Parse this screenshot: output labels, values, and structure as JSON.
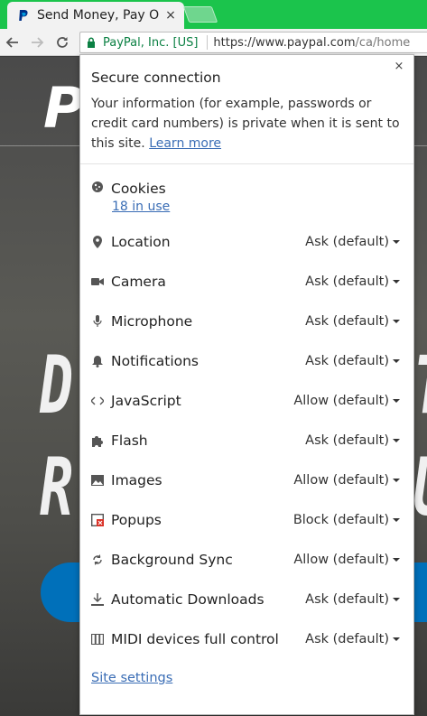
{
  "browser": {
    "tab": {
      "title": "Send Money, Pay O",
      "close_glyph": "×",
      "favicon": "paypal-favicon-icon"
    },
    "new_tab_icon": "new-tab-icon",
    "tabstrip_color": "#1bc44c",
    "nav": {
      "back": "arrow-left-icon",
      "forward": "arrow-right-icon",
      "reload": "reload-icon"
    },
    "omnibox": {
      "security_label": "PayPal, Inc. [US]",
      "url_scheme_host": "https://www.paypal.com",
      "url_path": "/ca/home",
      "secure_color": "#0b8043"
    }
  },
  "background_page": {
    "logo_letter": "P",
    "headline_line1": "D",
    "headline_line2": "R",
    "headline_line1_right": "T",
    "headline_line2_right": "U",
    "button_color": "#0070ba"
  },
  "site_info_popup": {
    "close_glyph": "×",
    "heading": "Secure connection",
    "description": "Your information (for example, passwords or credit card numbers) is private when it is sent to this site.",
    "learn_more": "Learn more",
    "link_color": "#3a6db5",
    "cookies": {
      "label": "Cookies",
      "count_link": "18 in use",
      "icon": "cookie-icon"
    },
    "permissions": [
      {
        "label": "Location",
        "value": "Ask (default)",
        "icon": "location-pin-icon"
      },
      {
        "label": "Camera",
        "value": "Ask (default)",
        "icon": "camera-icon"
      },
      {
        "label": "Microphone",
        "value": "Ask (default)",
        "icon": "microphone-icon"
      },
      {
        "label": "Notifications",
        "value": "Ask (default)",
        "icon": "bell-icon"
      },
      {
        "label": "JavaScript",
        "value": "Allow (default)",
        "icon": "code-icon"
      },
      {
        "label": "Flash",
        "value": "Ask (default)",
        "icon": "puzzle-icon"
      },
      {
        "label": "Images",
        "value": "Allow (default)",
        "icon": "image-icon"
      },
      {
        "label": "Popups",
        "value": "Block (default)",
        "icon": "popup-blocked-icon"
      },
      {
        "label": "Background Sync",
        "value": "Allow (default)",
        "icon": "sync-icon"
      },
      {
        "label": "Automatic Downloads",
        "value": "Ask (default)",
        "icon": "download-icon"
      },
      {
        "label": "MIDI devices full control",
        "value": "Ask (default)",
        "icon": "piano-keys-icon"
      }
    ],
    "site_settings_link": "Site settings"
  }
}
